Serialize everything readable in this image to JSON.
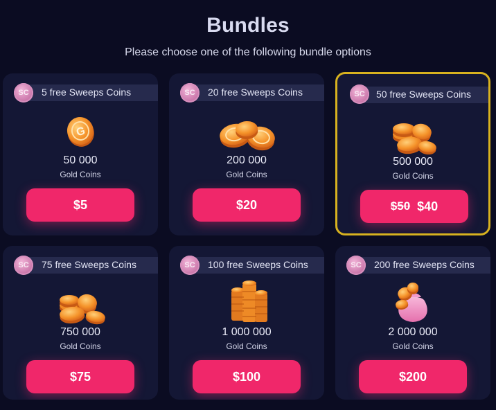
{
  "header": {
    "title": "Bundles",
    "subtitle": "Please choose one of the following bundle options"
  },
  "colors": {
    "background": "#0b0c22",
    "card": "#141735",
    "button": "#f0276a",
    "selected_border": "#d8b21f",
    "coin": "#f59a2a"
  },
  "bundles": [
    {
      "sc_badge": "SC",
      "sweeps": "5 free Sweeps Coins",
      "amount": "50 000",
      "unit": "Gold Coins",
      "price": "$5",
      "art_icon": "single-gold-coin-icon"
    },
    {
      "sc_badge": "SC",
      "sweeps": "20 free Sweeps Coins",
      "amount": "200 000",
      "unit": "Gold Coins",
      "price": "$20",
      "art_icon": "gold-coins-pile-icon"
    },
    {
      "sc_badge": "SC",
      "sweeps": "50 free Sweeps Coins",
      "amount": "500 000",
      "unit": "Gold Coins",
      "old_price": "$50",
      "price": "$40",
      "selected": true,
      "art_icon": "gold-coins-stack-icon"
    },
    {
      "sc_badge": "SC",
      "sweeps": "75 free Sweeps Coins",
      "amount": "750 000",
      "unit": "Gold Coins",
      "price": "$75",
      "art_icon": "gold-coins-heap-icon"
    },
    {
      "sc_badge": "SC",
      "sweeps": "100 free Sweeps Coins",
      "amount": "1 000 000",
      "unit": "Gold Coins",
      "price": "$100",
      "art_icon": "gold-coins-towers-icon"
    },
    {
      "sc_badge": "SC",
      "sweeps": "200 free Sweeps Coins",
      "amount": "2 000 000",
      "unit": "Gold Coins",
      "price": "$200",
      "art_icon": "coin-bag-icon"
    }
  ]
}
